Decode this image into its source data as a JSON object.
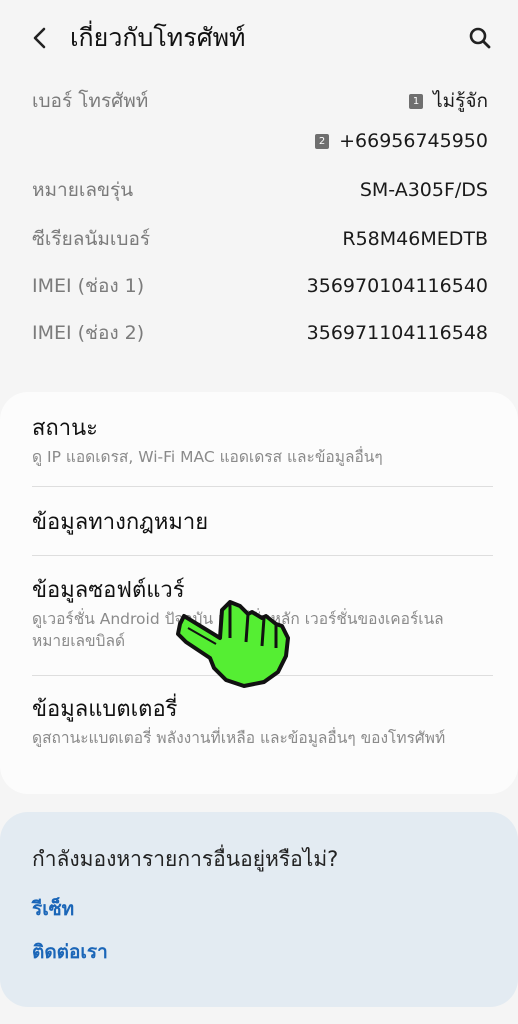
{
  "header": {
    "title": "เกี่ยวกับโทรศัพท์"
  },
  "phone_info": {
    "phone_number_label": "เบอร์ โทรศัพท์",
    "sim1_badge": "1",
    "sim1_value": "ไม่รู้จัก",
    "sim2_badge": "2",
    "sim2_value": "+66956745950",
    "model_label": "หมายเลขรุ่น",
    "model_value": "SM-A305F/DS",
    "serial_label": "ซีเรียลนัมเบอร์",
    "serial_value": "R58M46MEDTB",
    "imei1_label": "IMEI (ช่อง 1)",
    "imei1_value": "356970104116540",
    "imei2_label": "IMEI (ช่อง 2)",
    "imei2_value": "356971104116548"
  },
  "menu": {
    "status_title": "สถานะ",
    "status_sub": "ดู IP แอดเดรส, Wi-Fi MAC แอดเดรส และข้อมูลอื่นๆ",
    "legal_title": "ข้อมูลทางกฎหมาย",
    "software_title": "ข้อมูลซอฟต์แวร์",
    "software_sub": "ดูเวอร์ชั่น Android ปัจจุบัน เวอร์ชั่นหลัก เวอร์ชั่นของเคอร์เนล หมายเลขบิลด์",
    "battery_title": "ข้อมูลแบตเตอรี่",
    "battery_sub": "ดูสถานะแบตเตอรี่ พลังงานที่เหลือ และข้อมูลอื่นๆ ของโทรศัพท์"
  },
  "suggest": {
    "question": "กำลังมองหารายการอื่นอยู่หรือไม่?",
    "reset_link": "รีเซ็ท",
    "contact_link": "ติดต่อเรา"
  },
  "icons": {
    "back": "chevron-left-icon",
    "search": "search-icon",
    "pointer": "hand-pointer-icon"
  },
  "colors": {
    "background": "#f5f5f5",
    "card": "#fcfcfc",
    "suggest_card": "#e3ebf2",
    "link": "#1b66b8",
    "pointer_fill": "#55ee33"
  }
}
